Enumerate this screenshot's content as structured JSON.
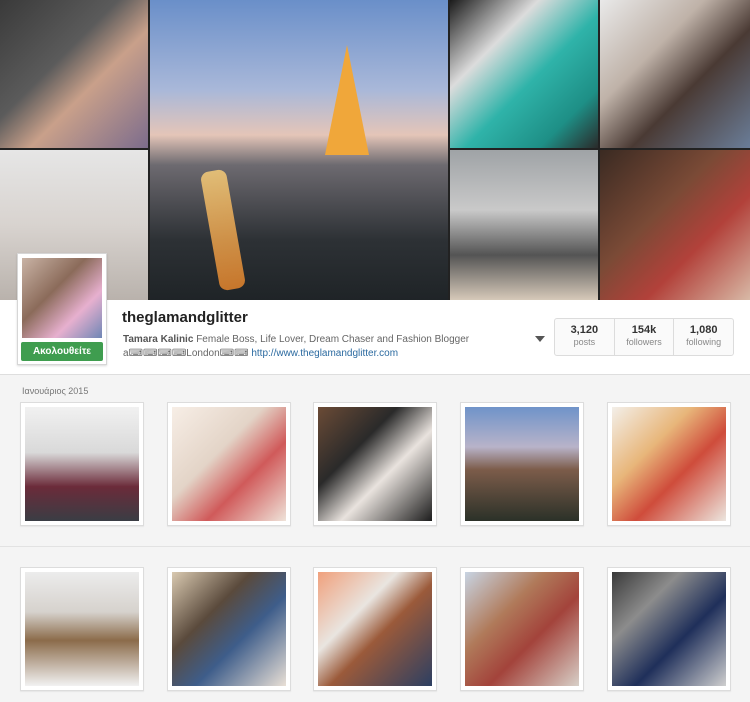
{
  "profile": {
    "username": "theglamandglitter",
    "full_name": "Tamara Kalinic",
    "bio": "Female Boss, Life Lover, Dream Chaser and Fashion Blogger",
    "location_line": "a⌨⌨⌨⌨London⌨⌨",
    "website": "http://www.theglamandglitter.com",
    "follow_label": "Ακολουθείτε"
  },
  "stats": [
    {
      "value": "3,120",
      "label": "posts"
    },
    {
      "value": "154k",
      "label": "followers"
    },
    {
      "value": "1,080",
      "label": "following"
    }
  ],
  "feed": {
    "section_label": "Ιανουάριος 2015"
  },
  "colors": {
    "follow_button": "#3f9d4f",
    "link": "#2b6aa0"
  }
}
